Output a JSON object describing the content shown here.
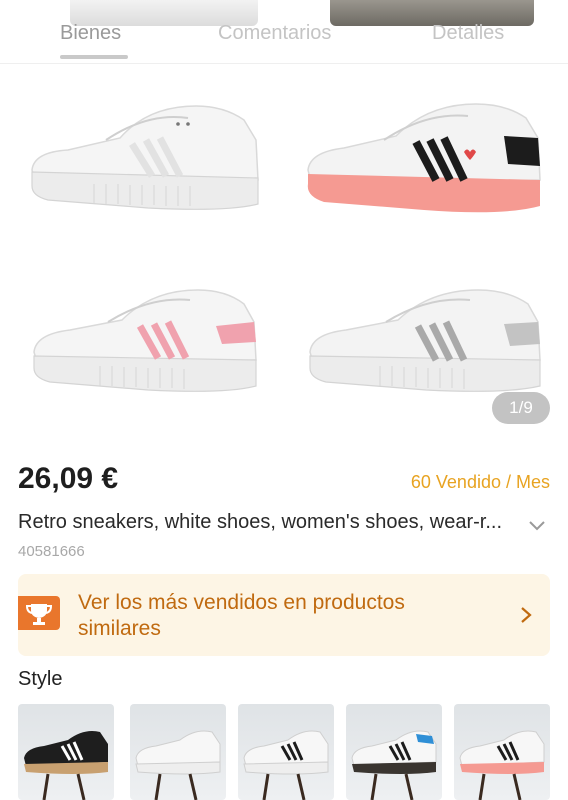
{
  "tabs": [
    {
      "label": "Bienes",
      "active": true
    },
    {
      "label": "Comentarios",
      "active": false
    },
    {
      "label": "Detalles",
      "active": false
    }
  ],
  "gallery": {
    "counter": "1/9",
    "images": [
      {
        "name": "white-stripes",
        "accent": "#e6e6e6"
      },
      {
        "name": "black-stripes-pink-sole",
        "accent": "#1c1c1c"
      },
      {
        "name": "pink-stripes",
        "accent": "#f0a2ae"
      },
      {
        "name": "silver-stripes",
        "accent": "#c0c0c0"
      }
    ]
  },
  "product": {
    "price": "26,09 €",
    "sold": "60 Vendido / Mes",
    "title": "Retro sneakers, white shoes, women's shoes, wear-r...",
    "id": "40581666"
  },
  "banner": {
    "text": "Ver los más vendidos en productos similares",
    "icon": "trophy-icon",
    "accent": "#e9762c"
  },
  "style": {
    "label": "Style",
    "options": [
      {
        "name": "black-white-gum"
      },
      {
        "name": "all-white"
      },
      {
        "name": "white-black"
      },
      {
        "name": "white-black-dark-sole"
      },
      {
        "name": "white-pink-sole"
      }
    ]
  },
  "colors": {
    "price": "#1e1e1e",
    "sold": "#e8a321",
    "banner_bg": "#fdf5e5",
    "banner_text": "#c06a10"
  }
}
